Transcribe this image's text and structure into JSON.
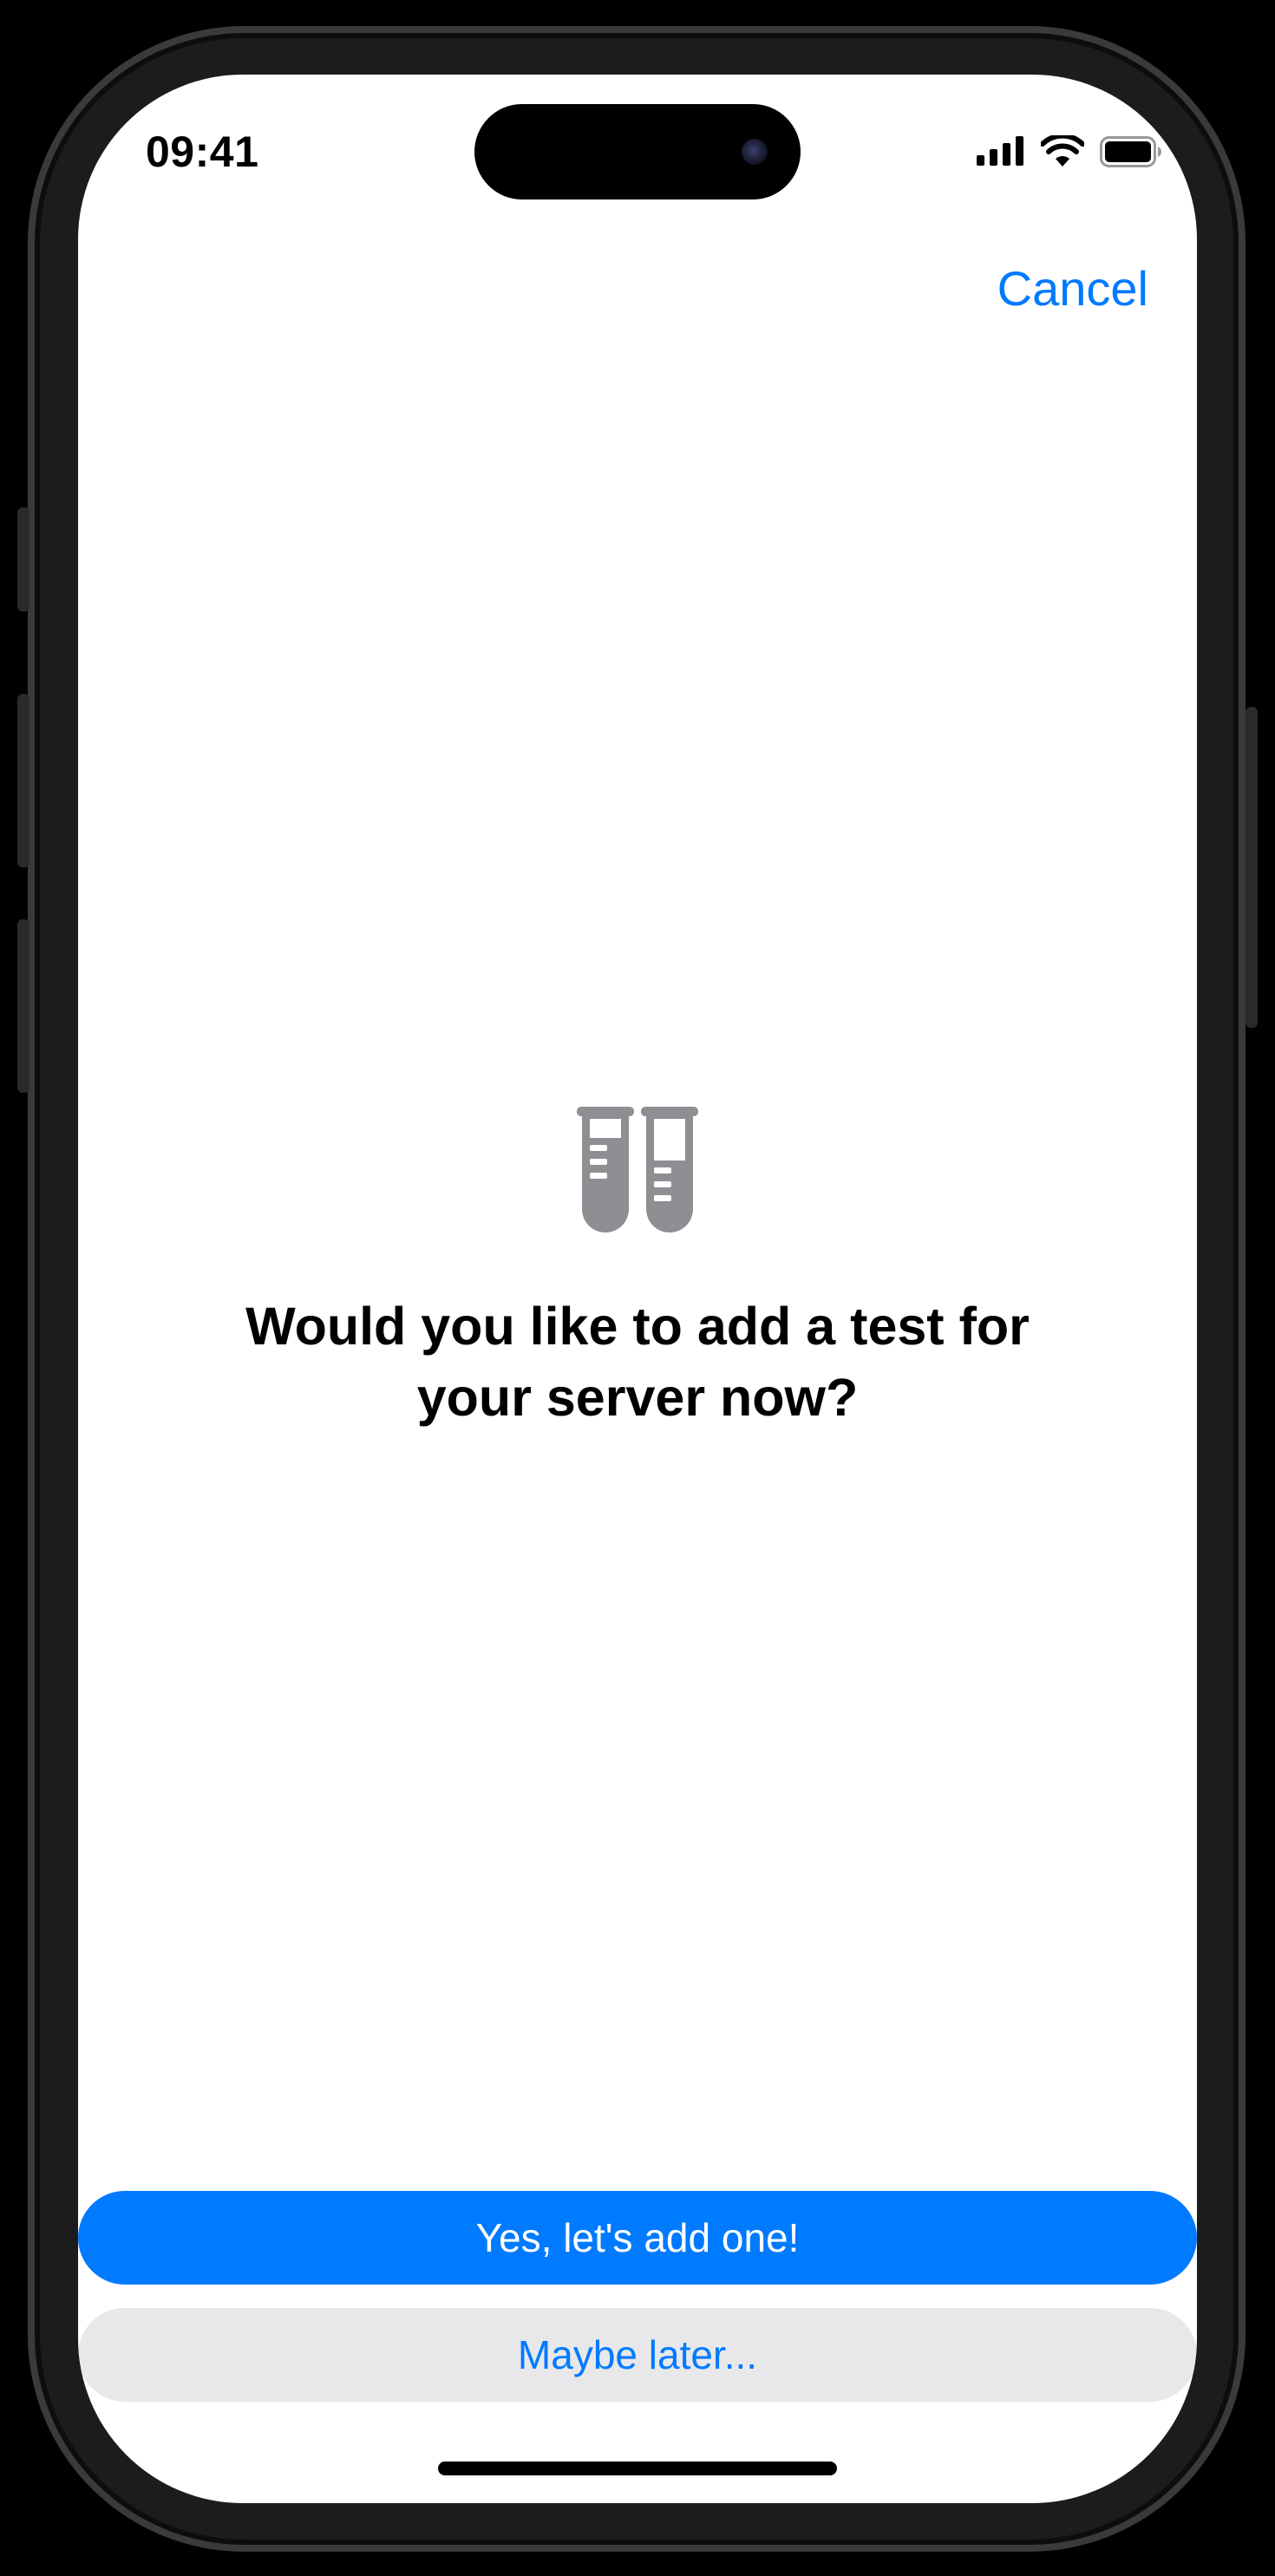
{
  "status_bar": {
    "time": "09:41",
    "icons": [
      "cellular-signal-icon",
      "wifi-icon",
      "battery-icon"
    ]
  },
  "nav": {
    "cancel_label": "Cancel"
  },
  "main": {
    "icon": "test-tubes-icon",
    "title": "Would you like to add a test for your server now?"
  },
  "actions": {
    "primary_label": "Yes, let's add one!",
    "secondary_label": "Maybe later..."
  },
  "colors": {
    "accent": "#007aff",
    "icon_gray": "#8e8e93",
    "secondary_button_bg": "#e8e8ea",
    "screen_bg": "#ffffff"
  }
}
